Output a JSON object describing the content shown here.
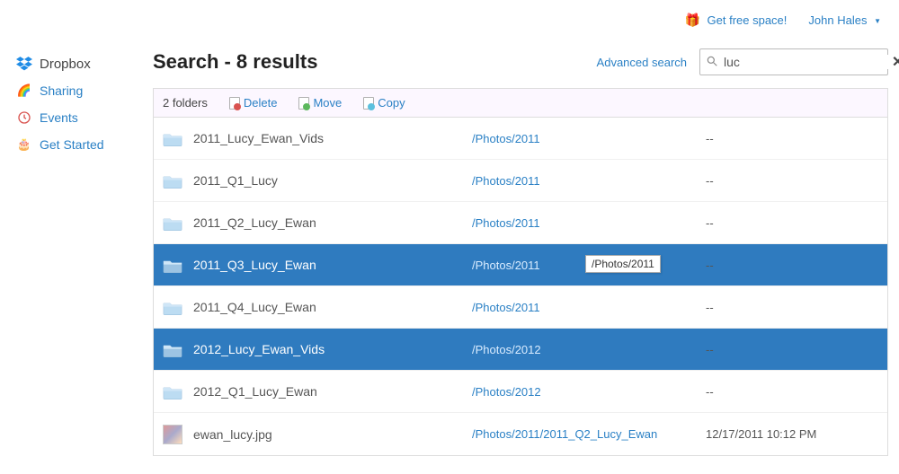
{
  "topbar": {
    "free_space": "Get free space!",
    "user": "John Hales"
  },
  "sidebar": {
    "items": [
      {
        "id": "dropbox",
        "label": "Dropbox"
      },
      {
        "id": "sharing",
        "label": "Sharing"
      },
      {
        "id": "events",
        "label": "Events"
      },
      {
        "id": "getstarted",
        "label": "Get Started"
      }
    ]
  },
  "header": {
    "title": "Search - 8 results",
    "advanced": "Advanced search"
  },
  "search": {
    "value": "luc"
  },
  "actionbar": {
    "selection": "2 folders",
    "delete_label": "Delete",
    "move_label": "Move",
    "copy_label": "Copy"
  },
  "results": [
    {
      "type": "folder",
      "name": "2011_Lucy_Ewan_Vids",
      "path": "/Photos/2011",
      "modified": "--",
      "selected": false
    },
    {
      "type": "folder",
      "name": "2011_Q1_Lucy",
      "path": "/Photos/2011",
      "modified": "--",
      "selected": false
    },
    {
      "type": "folder",
      "name": "2011_Q2_Lucy_Ewan",
      "path": "/Photos/2011",
      "modified": "--",
      "selected": false
    },
    {
      "type": "folder",
      "name": "2011_Q3_Lucy_Ewan",
      "path": "/Photos/2011",
      "modified": "--",
      "selected": true,
      "tooltip": "/Photos/2011"
    },
    {
      "type": "folder",
      "name": "2011_Q4_Lucy_Ewan",
      "path": "/Photos/2011",
      "modified": "--",
      "selected": false
    },
    {
      "type": "folder",
      "name": "2012_Lucy_Ewan_Vids",
      "path": "/Photos/2012",
      "modified": "--",
      "selected": true
    },
    {
      "type": "folder",
      "name": "2012_Q1_Lucy_Ewan",
      "path": "/Photos/2012",
      "modified": "--",
      "selected": false
    },
    {
      "type": "file",
      "name": "ewan_lucy.jpg",
      "path": "/Photos/2011/2011_Q2_Lucy_Ewan",
      "modified": "12/17/2011 10:12 PM",
      "selected": false
    }
  ]
}
